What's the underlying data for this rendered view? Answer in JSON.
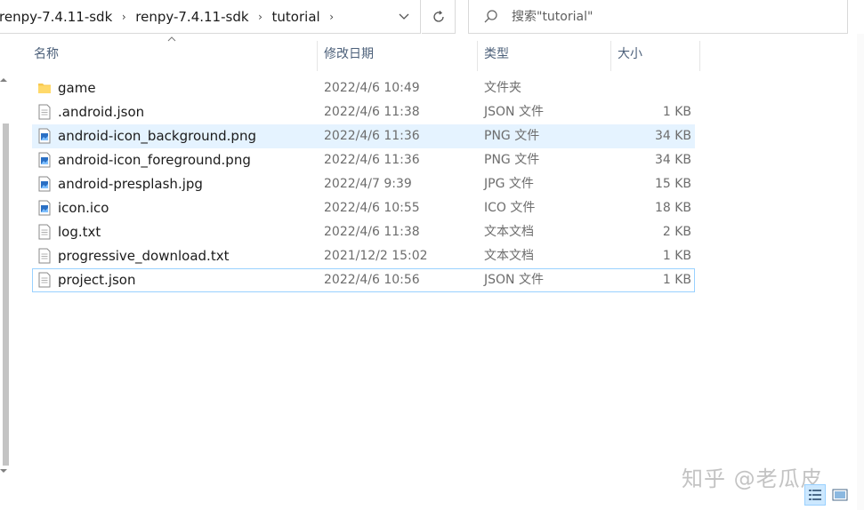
{
  "breadcrumb": {
    "items": [
      "renpy-7.4.11-sdk",
      "renpy-7.4.11-sdk",
      "tutorial"
    ],
    "separator": "›"
  },
  "search": {
    "placeholder": "搜索\"tutorial\""
  },
  "columns": {
    "name": "名称",
    "date": "修改日期",
    "type": "类型",
    "size": "大小"
  },
  "files": [
    {
      "name": "game",
      "date": "2022/4/6 10:49",
      "type": "文件夹",
      "size": "",
      "icon": "folder-icon"
    },
    {
      "name": ".android.json",
      "date": "2022/4/6 11:38",
      "type": "JSON 文件",
      "size": "1 KB",
      "icon": "text-file-icon"
    },
    {
      "name": "android-icon_background.png",
      "date": "2022/4/6 11:36",
      "type": "PNG 文件",
      "size": "34 KB",
      "icon": "image-file-icon"
    },
    {
      "name": "android-icon_foreground.png",
      "date": "2022/4/6 11:36",
      "type": "PNG 文件",
      "size": "34 KB",
      "icon": "image-file-icon"
    },
    {
      "name": "android-presplash.jpg",
      "date": "2022/4/7 9:39",
      "type": "JPG 文件",
      "size": "15 KB",
      "icon": "image-file-icon"
    },
    {
      "name": "icon.ico",
      "date": "2022/4/6 10:55",
      "type": "ICO 文件",
      "size": "18 KB",
      "icon": "image-file-icon"
    },
    {
      "name": "log.txt",
      "date": "2022/4/6 11:38",
      "type": "文本文档",
      "size": "2 KB",
      "icon": "text-file-icon"
    },
    {
      "name": "progressive_download.txt",
      "date": "2021/12/2 15:02",
      "type": "文本文档",
      "size": "1 KB",
      "icon": "text-file-icon"
    },
    {
      "name": "project.json",
      "date": "2022/4/6 10:56",
      "type": "JSON 文件",
      "size": "1 KB",
      "icon": "text-file-icon"
    }
  ],
  "selected_index": 2,
  "focused_index": 8,
  "watermark": "知乎 @老瓜皮",
  "colors": {
    "selection": "#e5f3ff",
    "focus_border": "#99d1ff",
    "header_text": "#4c607a",
    "folder": "#f8c950"
  }
}
